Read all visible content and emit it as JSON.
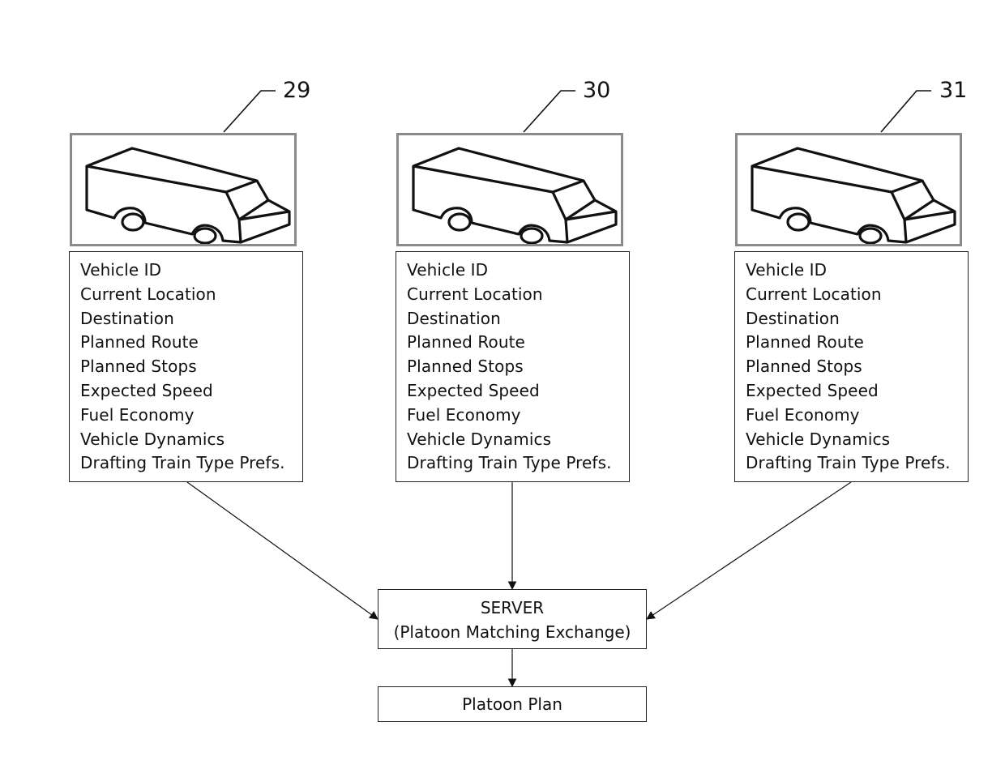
{
  "vehicles": [
    {
      "ref": "29",
      "fields": [
        "Vehicle ID",
        "Current Location",
        "Destination",
        "Planned Route",
        "Planned Stops",
        "Expected Speed",
        "Fuel Economy",
        "Vehicle Dynamics",
        "Drafting Train Type Prefs."
      ]
    },
    {
      "ref": "30",
      "fields": [
        "Vehicle ID",
        "Current Location",
        "Destination",
        "Planned Route",
        "Planned Stops",
        "Expected Speed",
        "Fuel Economy",
        "Vehicle Dynamics",
        "Drafting Train Type Prefs."
      ]
    },
    {
      "ref": "31",
      "fields": [
        "Vehicle ID",
        "Current Location",
        "Destination",
        "Planned Route",
        "Planned Stops",
        "Expected Speed",
        "Fuel Economy",
        "Vehicle Dynamics",
        "Drafting Train Type Prefs."
      ]
    }
  ],
  "server": {
    "title": "SERVER",
    "subtitle": "(Platoon Matching Exchange)"
  },
  "output": {
    "label": "Platoon Plan"
  },
  "colors": {
    "line": "#111111",
    "frame": "#8a8a8a"
  }
}
